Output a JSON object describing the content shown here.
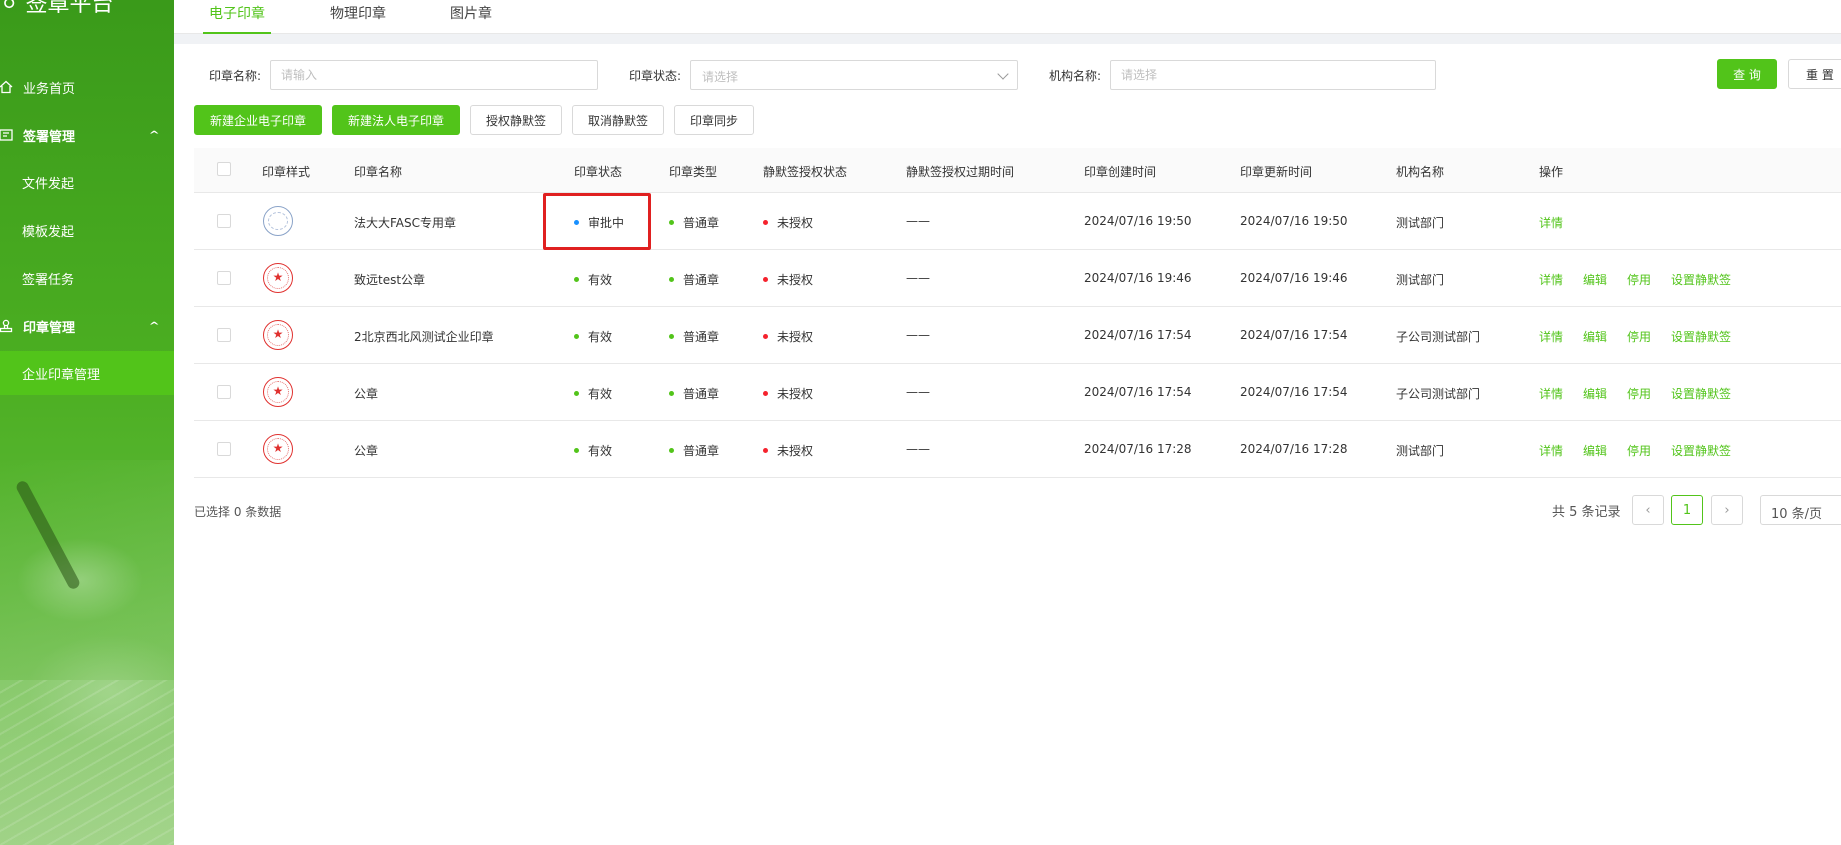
{
  "app": {
    "brand": "签章平台"
  },
  "sidebar": {
    "items": [
      {
        "label": "业务首页"
      },
      {
        "label": "签署管理"
      },
      {
        "label": "文件发起"
      },
      {
        "label": "模板发起"
      },
      {
        "label": "签署任务"
      },
      {
        "label": "印章管理"
      },
      {
        "label": "企业印章管理"
      }
    ]
  },
  "tabs": [
    {
      "label": "电子印章",
      "active": true
    },
    {
      "label": "物理印章"
    },
    {
      "label": "图片章"
    }
  ],
  "filters": {
    "seal_name": {
      "label": "印章名称:",
      "placeholder": "请输入",
      "value": ""
    },
    "seal_status": {
      "label": "印章状态:",
      "placeholder": "请选择"
    },
    "org_name": {
      "label": "机构名称:",
      "placeholder": "请选择",
      "value": ""
    },
    "query_label": "查 询",
    "reset_label": "重 置"
  },
  "actions": {
    "new_enterprise": "新建企业电子印章",
    "new_legal": "新建法人电子印章",
    "grant_silent": "授权静默签",
    "cancel_silent": "取消静默签",
    "sync": "印章同步"
  },
  "table": {
    "headers": [
      "印章样式",
      "印章名称",
      "印章状态",
      "印章类型",
      "静默签授权状态",
      "静默签授权过期时间",
      "印章创建时间",
      "印章更新时间",
      "机构名称",
      "操作"
    ],
    "rows": [
      {
        "seal_style": "blue",
        "name": "法大大FASC专用章",
        "status": "审批中",
        "status_color": "#1890ff",
        "type": "普通章",
        "type_color": "#52c41a",
        "silent": "未授权",
        "silent_color": "#f5222d",
        "expire": "——",
        "created": "2024/07/16 19:50",
        "updated": "2024/07/16 19:50",
        "org": "测试部门",
        "ops": [
          "详情"
        ]
      },
      {
        "seal_style": "red",
        "name": "致远test公章",
        "status": "有效",
        "status_color": "#52c41a",
        "type": "普通章",
        "type_color": "#52c41a",
        "silent": "未授权",
        "silent_color": "#f5222d",
        "expire": "——",
        "created": "2024/07/16 19:46",
        "updated": "2024/07/16 19:46",
        "org": "测试部门",
        "ops": [
          "详情",
          "编辑",
          "停用",
          "设置静默签"
        ]
      },
      {
        "seal_style": "red",
        "name": "2北京西北风测试企业印章",
        "status": "有效",
        "status_color": "#52c41a",
        "type": "普通章",
        "type_color": "#52c41a",
        "silent": "未授权",
        "silent_color": "#f5222d",
        "expire": "——",
        "created": "2024/07/16 17:54",
        "updated": "2024/07/16 17:54",
        "org": "子公司测试部门",
        "ops": [
          "详情",
          "编辑",
          "停用",
          "设置静默签"
        ]
      },
      {
        "seal_style": "red",
        "name": "公章",
        "status": "有效",
        "status_color": "#52c41a",
        "type": "普通章",
        "type_color": "#52c41a",
        "silent": "未授权",
        "silent_color": "#f5222d",
        "expire": "——",
        "created": "2024/07/16 17:54",
        "updated": "2024/07/16 17:54",
        "org": "子公司测试部门",
        "ops": [
          "详情",
          "编辑",
          "停用",
          "设置静默签"
        ]
      },
      {
        "seal_style": "red",
        "name": "公章",
        "status": "有效",
        "status_color": "#52c41a",
        "type": "普通章",
        "type_color": "#52c41a",
        "silent": "未授权",
        "silent_color": "#f5222d",
        "expire": "——",
        "created": "2024/07/16 17:28",
        "updated": "2024/07/16 17:28",
        "org": "测试部门",
        "ops": [
          "详情",
          "编辑",
          "停用",
          "设置静默签"
        ]
      }
    ]
  },
  "footer": {
    "selected": "已选择 0 条数据",
    "total": "共 5 条记录",
    "current_page": "1",
    "page_size": "10 条/页"
  },
  "icons": {
    "home": "home-icon",
    "sign_mgmt": "stamp-icon",
    "seal_mgmt": "seal-icon",
    "expand": "chevron-up-icon"
  },
  "colors": {
    "accent": "#52c41a",
    "status_pending": "#1890ff",
    "status_valid": "#52c41a",
    "unauthorized": "#f5222d",
    "highlight_box": "#e02020"
  }
}
